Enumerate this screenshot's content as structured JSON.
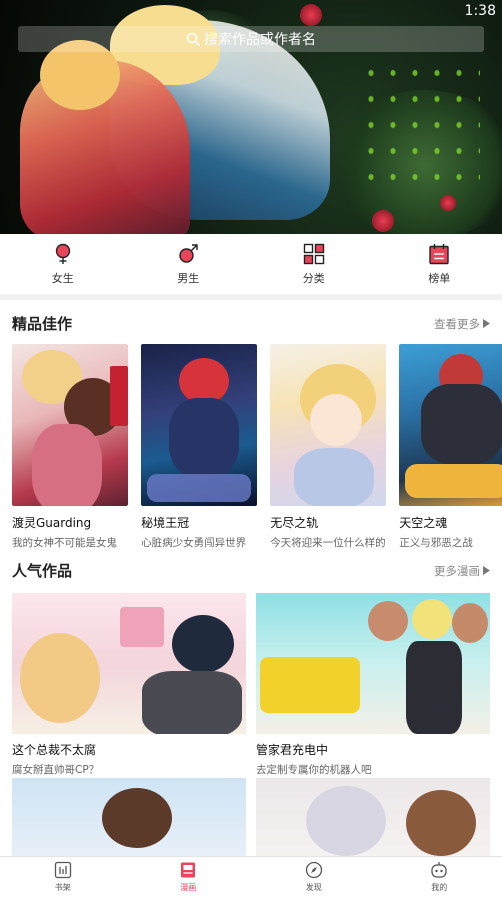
{
  "status": {
    "time": "1:38"
  },
  "search": {
    "placeholder": "搜索作品或作者名"
  },
  "categories": [
    {
      "label": "女生",
      "icon": "female-symbol-icon"
    },
    {
      "label": "男生",
      "icon": "male-symbol-icon"
    },
    {
      "label": "分类",
      "icon": "grid-icon"
    },
    {
      "label": "榜单",
      "icon": "ranking-board-icon"
    }
  ],
  "featured": {
    "title": "精品佳作",
    "more": "查看更多",
    "items": [
      {
        "title": "渡灵Guarding",
        "subtitle": "我的女神不可能是女鬼"
      },
      {
        "title": "秘境王冠",
        "subtitle": "心脏病少女勇闯异世界"
      },
      {
        "title": "无尽之轨",
        "subtitle": "今天将迎来一位什么样的"
      },
      {
        "title": "天空之魂",
        "subtitle": "正义与邪恶之战"
      }
    ]
  },
  "popular": {
    "title": "人气作品",
    "more": "更多漫画",
    "items": [
      {
        "title": "这个总裁不太腐",
        "subtitle": "腐女掰直帅哥CP？"
      },
      {
        "title": "管家君充电中",
        "subtitle": "去定制专属你的机器人吧"
      }
    ]
  },
  "tabs": [
    {
      "label": "书架",
      "icon": "bookshelf-icon",
      "active": false
    },
    {
      "label": "漫画",
      "icon": "comic-book-icon",
      "active": true
    },
    {
      "label": "发现",
      "icon": "compass-icon",
      "active": false
    },
    {
      "label": "我的",
      "icon": "robot-face-icon",
      "active": false
    }
  ],
  "colors": {
    "accent": "#e8455a",
    "text": "#222222",
    "muted": "#888888"
  }
}
